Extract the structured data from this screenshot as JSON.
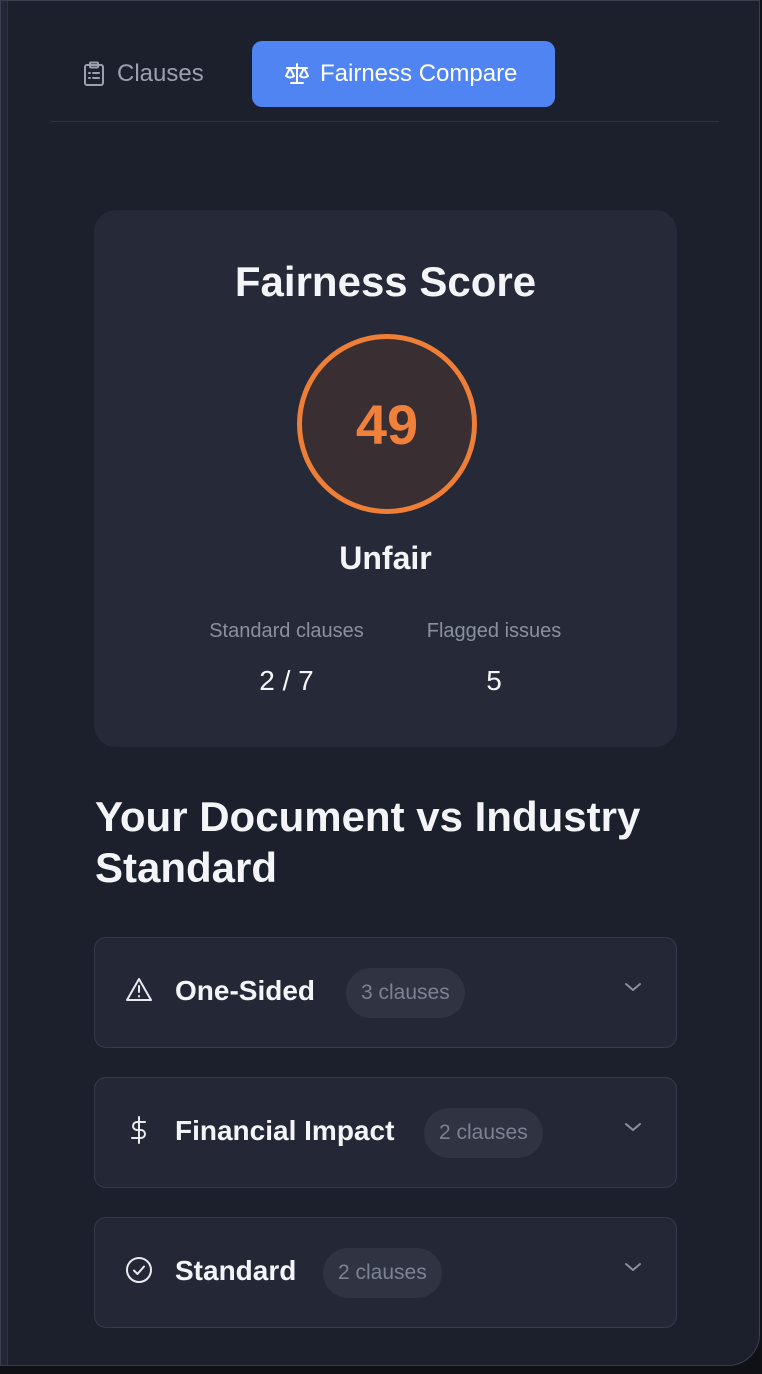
{
  "tabs": [
    {
      "label": "Clauses",
      "icon": "clipboard-list-icon",
      "active": false
    },
    {
      "label": "Fairness Compare",
      "icon": "scale-icon",
      "active": true
    }
  ],
  "score_card": {
    "title": "Fairness Score",
    "score": "49",
    "score_color": "#ef7f36",
    "verdict": "Unfair",
    "stats": [
      {
        "label": "Standard clauses",
        "value": "2 / 7"
      },
      {
        "label": "Flagged issues",
        "value": "5"
      }
    ]
  },
  "comparison": {
    "heading": "Your Document vs Industry Standard",
    "categories": [
      {
        "label": "One-Sided",
        "count": "3 clauses",
        "icon": "warning-triangle-icon"
      },
      {
        "label": "Financial Impact",
        "count": "2 clauses",
        "icon": "dollar-icon"
      },
      {
        "label": "Standard",
        "count": "2 clauses",
        "icon": "check-circle-icon"
      }
    ]
  },
  "colors": {
    "background": "#1c1f2c",
    "card": "#262a38",
    "accent": "#4f84f2",
    "score": "#ef7f36"
  }
}
